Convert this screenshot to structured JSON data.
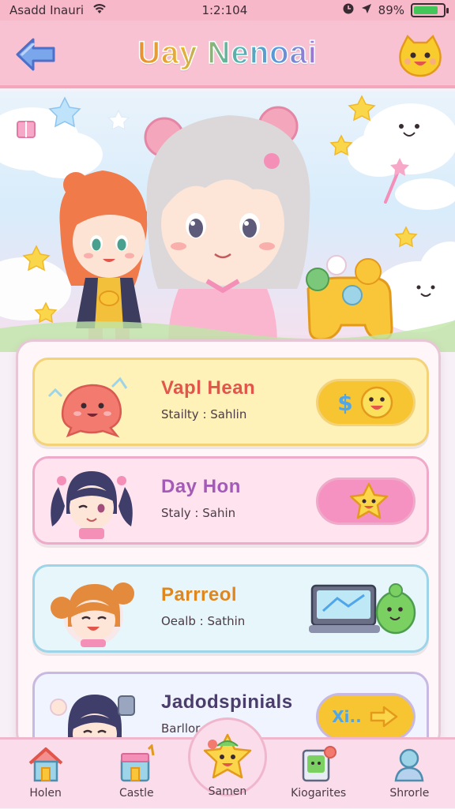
{
  "status_bar": {
    "carrier": "Asadd Inauri",
    "time": "1:2:104",
    "battery": "89%",
    "battery_level": 0.82
  },
  "header": {
    "title": "Uay Nenoai",
    "back_icon": "arrow-left-icon",
    "mascot_icon": "mascot-face-icon"
  },
  "cards": [
    {
      "name": "Vapl Hean",
      "subtitle": "Stailty : Sahlin",
      "accent": "#f3d27a",
      "bg": "#fff2b8",
      "name_color": "#e2554b",
      "action_text": "$",
      "action_bg": "#f7c531"
    },
    {
      "name": "Day Hon",
      "subtitle": "Staly : Sahin",
      "accent": "#efa9c9",
      "bg": "#ffe3ef",
      "name_color": "#a45bb8",
      "action_text": "",
      "action_bg": "#f592c2"
    },
    {
      "name": "Parrreol",
      "subtitle": "Oealb : Sathin",
      "accent": "#9ed4e8",
      "bg": "#e6f6fb",
      "name_color": "#e0861f",
      "action_text": "",
      "action_bg": "#f4fbff"
    },
    {
      "name": "Jadodspinials",
      "subtitle": "Barllor",
      "accent": "#c8b9e2",
      "bg": "#eff4ff",
      "name_color": "#4a3c6b",
      "action_text": "Xi..",
      "action_bg": "#f7c531"
    }
  ],
  "nav": {
    "items": [
      {
        "label": "Holen",
        "icon": "house-icon"
      },
      {
        "label": "Castle",
        "icon": "castle-icon"
      },
      {
        "label": "Samen",
        "icon": "star-mascot-icon"
      },
      {
        "label": "Kiogarites",
        "icon": "card-frame-icon"
      },
      {
        "label": "Shrorle",
        "icon": "profile-icon"
      }
    ]
  },
  "colors": {
    "header_bg": "#f9c2d2",
    "panel_bg": "#fff6fa",
    "nav_bg": "#fbdcea"
  }
}
